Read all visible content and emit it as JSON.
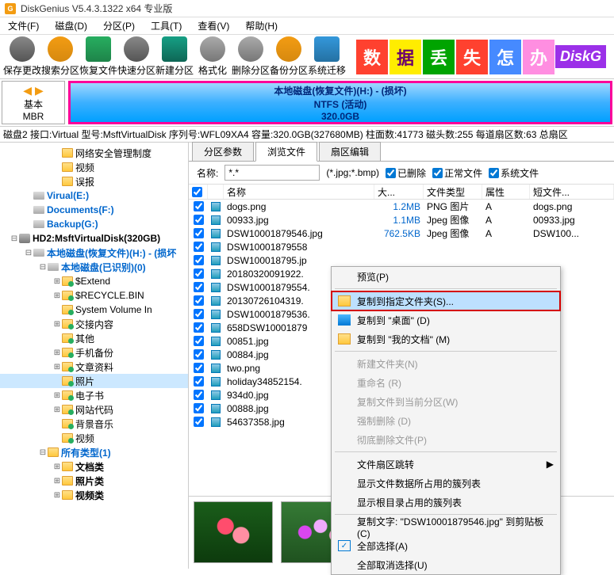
{
  "app": {
    "title": "DiskGenius V5.4.3.1322 x64 专业版"
  },
  "menu": [
    "文件(F)",
    "磁盘(D)",
    "分区(P)",
    "工具(T)",
    "查看(V)",
    "帮助(H)"
  ],
  "tools": [
    "保存更改",
    "搜索分区",
    "恢复文件",
    "快速分区",
    "新建分区",
    "格式化",
    "删除分区",
    "备份分区",
    "系统迁移"
  ],
  "banner": {
    "chars": [
      "数",
      "据",
      "丢",
      "失",
      "怎",
      "办"
    ],
    "brand": "DiskG"
  },
  "disk_basic": {
    "lr": "◀ ▶",
    "l1": "基本",
    "l2": "MBR"
  },
  "disk_bar": {
    "l1": "本地磁盘(恢复文件)(H:) - (损坏)",
    "l2": "NTFS (活动)",
    "l3": "320.0GB"
  },
  "disk_info": "磁盘2  接口:Virtual   型号:MsftVirtualDisk   序列号:WFL09XA4   容量:320.0GB(327680MB)   柱面数:41773   磁头数:255   每道扇区数:63   总扇区",
  "tree": [
    {
      "ind": 3,
      "exp": "",
      "ico": "folder",
      "cls": "",
      "txt": "网络安全管理制度"
    },
    {
      "ind": 3,
      "exp": "",
      "ico": "folder",
      "cls": "",
      "txt": "视频"
    },
    {
      "ind": 3,
      "exp": "",
      "ico": "folder",
      "cls": "",
      "txt": "误报"
    },
    {
      "ind": 1,
      "exp": "",
      "ico": "drive",
      "cls": "blue b",
      "txt": "Virual(E:)"
    },
    {
      "ind": 1,
      "exp": "",
      "ico": "drive",
      "cls": "blue b",
      "txt": "Documents(F:)"
    },
    {
      "ind": 1,
      "exp": "",
      "ico": "drive",
      "cls": "blue b",
      "txt": "Backup(G:)"
    },
    {
      "ind": 0,
      "exp": "⊟",
      "ico": "hdd",
      "cls": "b",
      "txt": "HD2:MsftVirtualDisk(320GB)"
    },
    {
      "ind": 1,
      "exp": "⊟",
      "ico": "drive",
      "cls": "blue b",
      "txt": "本地磁盘(恢复文件)(H:) - (损坏"
    },
    {
      "ind": 2,
      "exp": "⊟",
      "ico": "drive",
      "cls": "blue b",
      "txt": "本地磁盘(已识别)(0)"
    },
    {
      "ind": 3,
      "exp": "⊞",
      "ico": "folder-g",
      "cls": "",
      "txt": "$Extend"
    },
    {
      "ind": 3,
      "exp": "⊞",
      "ico": "folder-g",
      "cls": "",
      "txt": "$RECYCLE.BIN"
    },
    {
      "ind": 3,
      "exp": "",
      "ico": "folder-g",
      "cls": "",
      "txt": "System Volume In"
    },
    {
      "ind": 3,
      "exp": "⊞",
      "ico": "folder-g",
      "cls": "",
      "txt": "交接内容"
    },
    {
      "ind": 3,
      "exp": "",
      "ico": "folder-g",
      "cls": "",
      "txt": "其他"
    },
    {
      "ind": 3,
      "exp": "⊞",
      "ico": "folder-g",
      "cls": "",
      "txt": "手机备份"
    },
    {
      "ind": 3,
      "exp": "⊞",
      "ico": "folder-g",
      "cls": "",
      "txt": "文章资料"
    },
    {
      "ind": 3,
      "exp": "",
      "ico": "folder-g",
      "cls": "selected",
      "txt": "照片"
    },
    {
      "ind": 3,
      "exp": "⊞",
      "ico": "folder-g",
      "cls": "",
      "txt": "电子书"
    },
    {
      "ind": 3,
      "exp": "⊞",
      "ico": "folder-g",
      "cls": "",
      "txt": "网站代码"
    },
    {
      "ind": 3,
      "exp": "",
      "ico": "folder-g",
      "cls": "",
      "txt": "背景音乐"
    },
    {
      "ind": 3,
      "exp": "",
      "ico": "folder-g",
      "cls": "",
      "txt": "视频"
    },
    {
      "ind": 2,
      "exp": "⊟",
      "ico": "folder",
      "cls": "blue b",
      "txt": "所有类型(1)"
    },
    {
      "ind": 3,
      "exp": "⊞",
      "ico": "folder",
      "cls": "b",
      "txt": "文档类"
    },
    {
      "ind": 3,
      "exp": "⊞",
      "ico": "folder",
      "cls": "b",
      "txt": "照片类"
    },
    {
      "ind": 3,
      "exp": "⊞",
      "ico": "folder",
      "cls": "b",
      "txt": "视频类"
    }
  ],
  "tabs": [
    "分区参数",
    "浏览文件",
    "扇区编辑"
  ],
  "filter": {
    "name_label": "名称:",
    "name_value": "*.*",
    "exts": "(*.jpg;*.bmp)",
    "c1": "已删除",
    "c2": "正常文件",
    "c3": "系统文件"
  },
  "cols": {
    "name": "名称",
    "size": "大...",
    "type": "文件类型",
    "attr": "属性",
    "sname": "短文件..."
  },
  "files": [
    {
      "n": "dogs.png",
      "s": "1.2MB",
      "t": "PNG 图片",
      "a": "A",
      "sn": "dogs.png"
    },
    {
      "n": "00933.jpg",
      "s": "1.1MB",
      "t": "Jpeg 图像",
      "a": "A",
      "sn": "00933.jpg"
    },
    {
      "n": "DSW10001879546.jpg",
      "s": "762.5KB",
      "t": "Jpeg 图像",
      "a": "A",
      "sn": "DSW100..."
    },
    {
      "n": "DSW10001879558",
      "s": "",
      "t": "",
      "a": "",
      "sn": ""
    },
    {
      "n": "DSW100018795.jp",
      "s": "",
      "t": "",
      "a": "",
      "sn": ""
    },
    {
      "n": "20180320091922.",
      "s": "",
      "t": "",
      "a": "",
      "sn": ""
    },
    {
      "n": "DSW10001879554.",
      "s": "",
      "t": "",
      "a": "",
      "sn": ""
    },
    {
      "n": "20130726104319.",
      "s": "",
      "t": "",
      "a": "",
      "sn": ""
    },
    {
      "n": "DSW10001879536.",
      "s": "",
      "t": "",
      "a": "",
      "sn": ""
    },
    {
      "n": "658DSW10001879",
      "s": "",
      "t": "",
      "a": "",
      "sn": ""
    },
    {
      "n": "00851.jpg",
      "s": "",
      "t": "",
      "a": "",
      "sn": ""
    },
    {
      "n": "00884.jpg",
      "s": "",
      "t": "",
      "a": "",
      "sn": ""
    },
    {
      "n": "two.png",
      "s": "",
      "t": "",
      "a": "",
      "sn": ""
    },
    {
      "n": "holiday34852154.",
      "s": "",
      "t": "",
      "a": "",
      "sn": ""
    },
    {
      "n": "934d0.jpg",
      "s": "",
      "t": "",
      "a": "",
      "sn": ""
    },
    {
      "n": "00888.jpg",
      "s": "",
      "t": "",
      "a": "",
      "sn": ""
    },
    {
      "n": "54637358.jpg",
      "s": "",
      "t": "",
      "a": "",
      "sn": ""
    }
  ],
  "ctx": {
    "preview": "预览(P)",
    "copy_to": "复制到指定文件夹(S)...",
    "copy_desktop": "复制到 \"桌面\"   (D)",
    "copy_docs": "复制到 \"我的文档\"   (M)",
    "new_folder": "新建文件夹(N)",
    "rename": "重命名   (R)",
    "copy_cur": "复制文件到当前分区(W)",
    "force_del": "强制删除   (D)",
    "full_del": "彻底删除文件(P)",
    "cluster": "文件扇区跳转",
    "show_file": "显示文件数据所占用的簇列表",
    "show_root": "显示根目录占用的簇列表",
    "copy_text": "复制文字: \"DSW10001879546.jpg\" 到剪贴板(C)",
    "select_all": "全部选择(A)",
    "deselect_all": "全部取消选择(U)"
  }
}
